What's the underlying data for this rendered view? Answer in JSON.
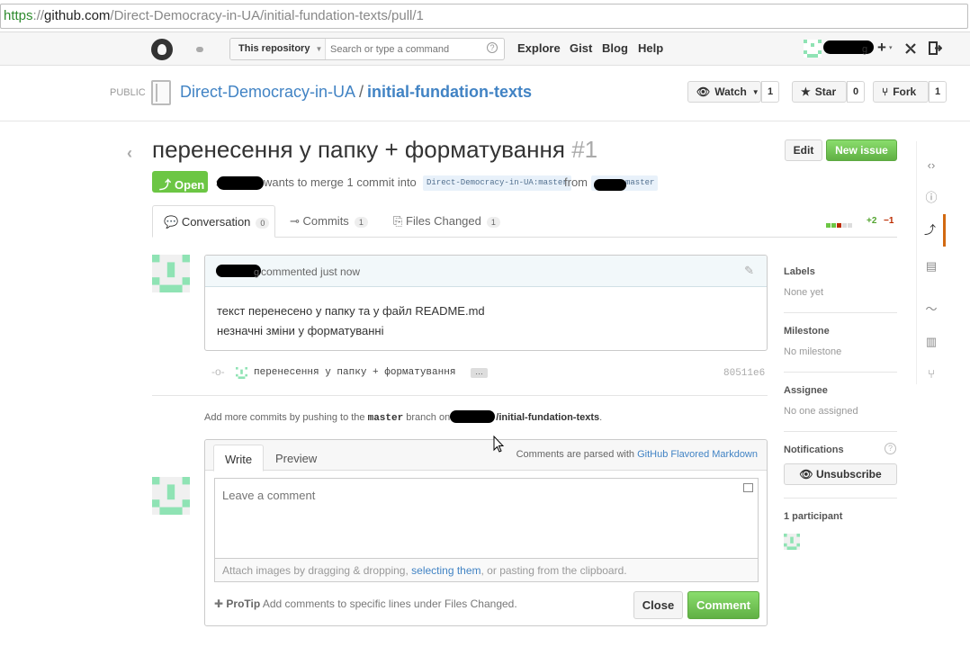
{
  "browser": {
    "url_scheme": "https",
    "url_sep": "://",
    "url_host": "github.com",
    "url_path": "/Direct-Democracy-in-UA/initial-fundation-texts/pull/1"
  },
  "nav": {
    "scope_label": "This repository",
    "search_placeholder": "Search or type a command",
    "search_help": "?",
    "links": [
      "Explore",
      "Gist",
      "Blog",
      "Help"
    ],
    "plus": "+",
    "user_suffix": "g"
  },
  "repo": {
    "visibility": "PUBLIC",
    "owner": "Direct-Democracy-in-UA",
    "separator": "/",
    "name": "initial-fundation-texts",
    "watch": {
      "label": "Watch",
      "count": "1"
    },
    "star": {
      "label": "Star",
      "count": "0"
    },
    "fork": {
      "label": "Fork",
      "count": "1"
    }
  },
  "pr": {
    "title": "перенесення у папку + форматування",
    "number": "#1",
    "edit_label": "Edit",
    "new_issue_label": "New issue",
    "state": "Open",
    "meta_text": "wants to merge 1 commit into",
    "base_branch": "Direct-Democracy-in-UA:master",
    "from_text": "from",
    "head_branch": "master",
    "author_prefix": "s"
  },
  "tabs": [
    {
      "label": "Conversation",
      "count": "0"
    },
    {
      "label": "Commits",
      "count": "1"
    },
    {
      "label": "Files Changed",
      "count": "1"
    }
  ],
  "diffstat": {
    "additions": "+2",
    "deletions": "−1",
    "colors": [
      "#6cc644",
      "#6cc644",
      "#bd2c00",
      "#ddd",
      "#ddd"
    ]
  },
  "comment": {
    "author_suffix": "g",
    "action": "commented just now",
    "lines": [
      "текст перенесено у папку та у файл README.md",
      "незначні зміни у форматуванні"
    ]
  },
  "commit": {
    "message": "перенесення у папку + форматування",
    "ellipsis": "…",
    "sha": "80511e6"
  },
  "push_note": {
    "prefix": "Add more commits by pushing to the",
    "branch": "master",
    "middle": "branch on",
    "repo_suffix": "/initial-fundation-texts",
    "end": "."
  },
  "composer": {
    "write_tab": "Write",
    "preview_tab": "Preview",
    "md_prefix": "Comments are parsed with",
    "md_link": "GitHub Flavored Markdown",
    "placeholder": "Leave a comment",
    "attach_prefix": "Attach images by dragging & dropping,",
    "attach_link": "selecting them",
    "attach_suffix": ", or pasting from the clipboard.",
    "protip_label": "ProTip",
    "protip_text": "Add comments to specific lines under Files Changed.",
    "close_label": "Close",
    "comment_label": "Comment"
  },
  "sidebar": {
    "labels_title": "Labels",
    "labels_value": "None yet",
    "milestone_title": "Milestone",
    "milestone_value": "No milestone",
    "assignee_title": "Assignee",
    "assignee_value": "No one assigned",
    "notifications_title": "Notifications",
    "notifications_help": "?",
    "unsubscribe_label": "Unsubscribe",
    "participants_title": "1 participant"
  },
  "rail_icons": [
    "code-icon",
    "issue-icon",
    "pull-request-icon",
    "wiki-icon",
    "pulse-icon",
    "graphs-icon",
    "network-icon"
  ],
  "accent_color": "#4183c4"
}
